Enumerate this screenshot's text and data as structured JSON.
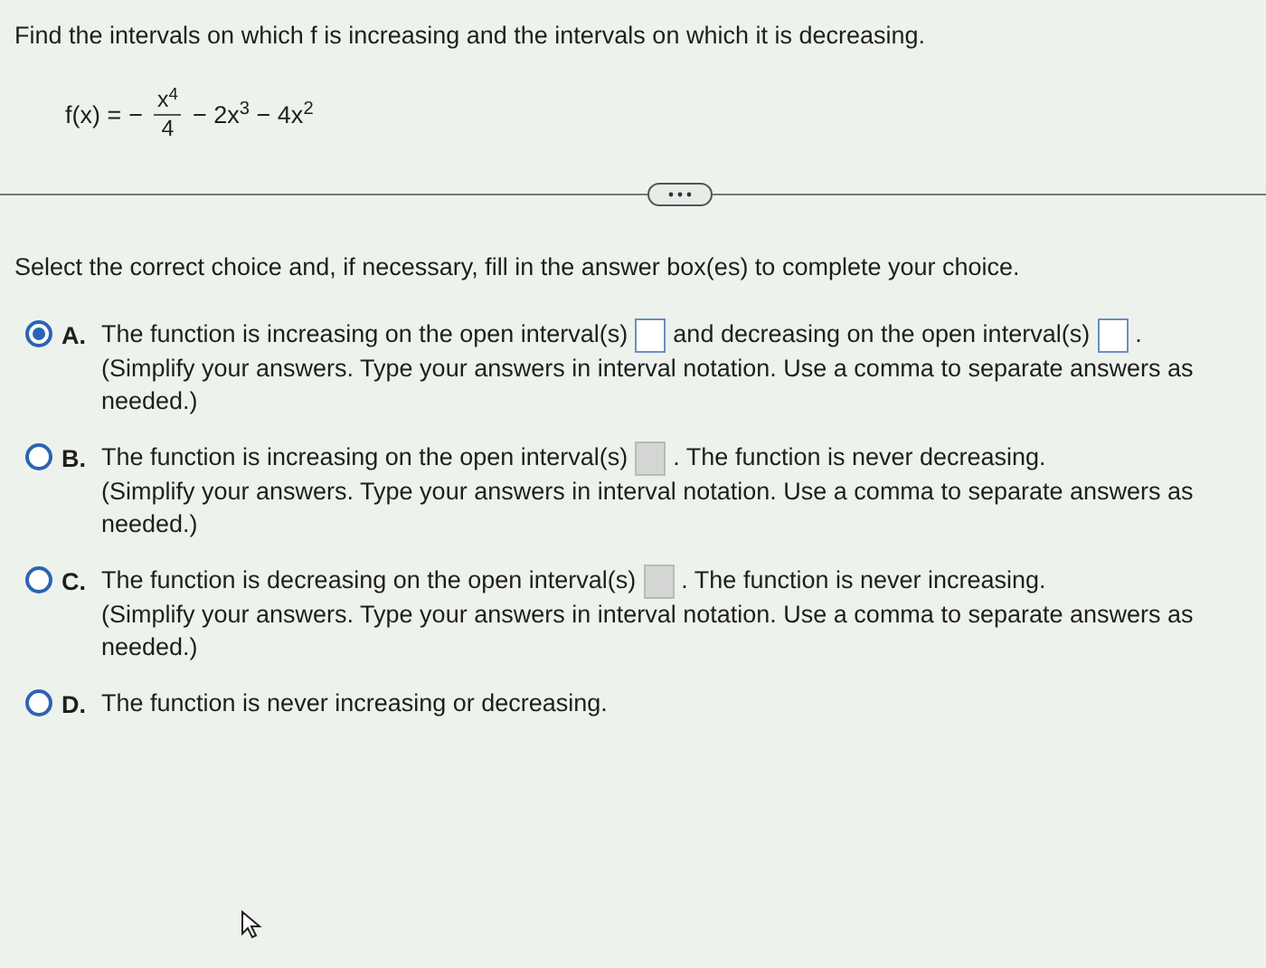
{
  "question": "Find the intervals on which f is increasing and the intervals on which it is decreasing.",
  "formula": {
    "lhs": "f(x) =",
    "sign": "−",
    "numerator": "x$^{4}$",
    "denominator": "4",
    "rest": "− 2x$^{3}$ − 4x$^{2}$"
  },
  "instruction": "Select the correct choice and, if necessary, fill in the answer box(es) to complete your choice.",
  "choices": [
    {
      "letter": "A.",
      "selected": true,
      "parts": [
        {
          "kind": "text",
          "text": "The function is increasing on the open interval(s)"
        },
        {
          "kind": "field",
          "disabled": false
        },
        {
          "kind": "text",
          "text": "and decreasing on the open interval(s)"
        },
        {
          "kind": "field",
          "disabled": false
        },
        {
          "kind": "text",
          "text": "."
        }
      ],
      "note": "(Simplify your answers. Type your answers in interval notation. Use a comma to separate answers as needed.)"
    },
    {
      "letter": "B.",
      "selected": false,
      "parts": [
        {
          "kind": "text",
          "text": "The function is increasing on the open interval(s)"
        },
        {
          "kind": "field",
          "disabled": true
        },
        {
          "kind": "text",
          "text": ". The function is never decreasing."
        }
      ],
      "note": "(Simplify your answers. Type your answers in interval notation. Use a comma to separate answers as needed.)"
    },
    {
      "letter": "C.",
      "selected": false,
      "parts": [
        {
          "kind": "text",
          "text": "The function is decreasing on the open interval(s)"
        },
        {
          "kind": "field",
          "disabled": true
        },
        {
          "kind": "text",
          "text": ". The function is never increasing."
        }
      ],
      "note": "(Simplify your answers. Type your answers in interval notation. Use a comma to separate answers as needed.)"
    },
    {
      "letter": "D.",
      "selected": false,
      "parts": [
        {
          "kind": "text",
          "text": "The function is never increasing or decreasing."
        }
      ]
    }
  ]
}
